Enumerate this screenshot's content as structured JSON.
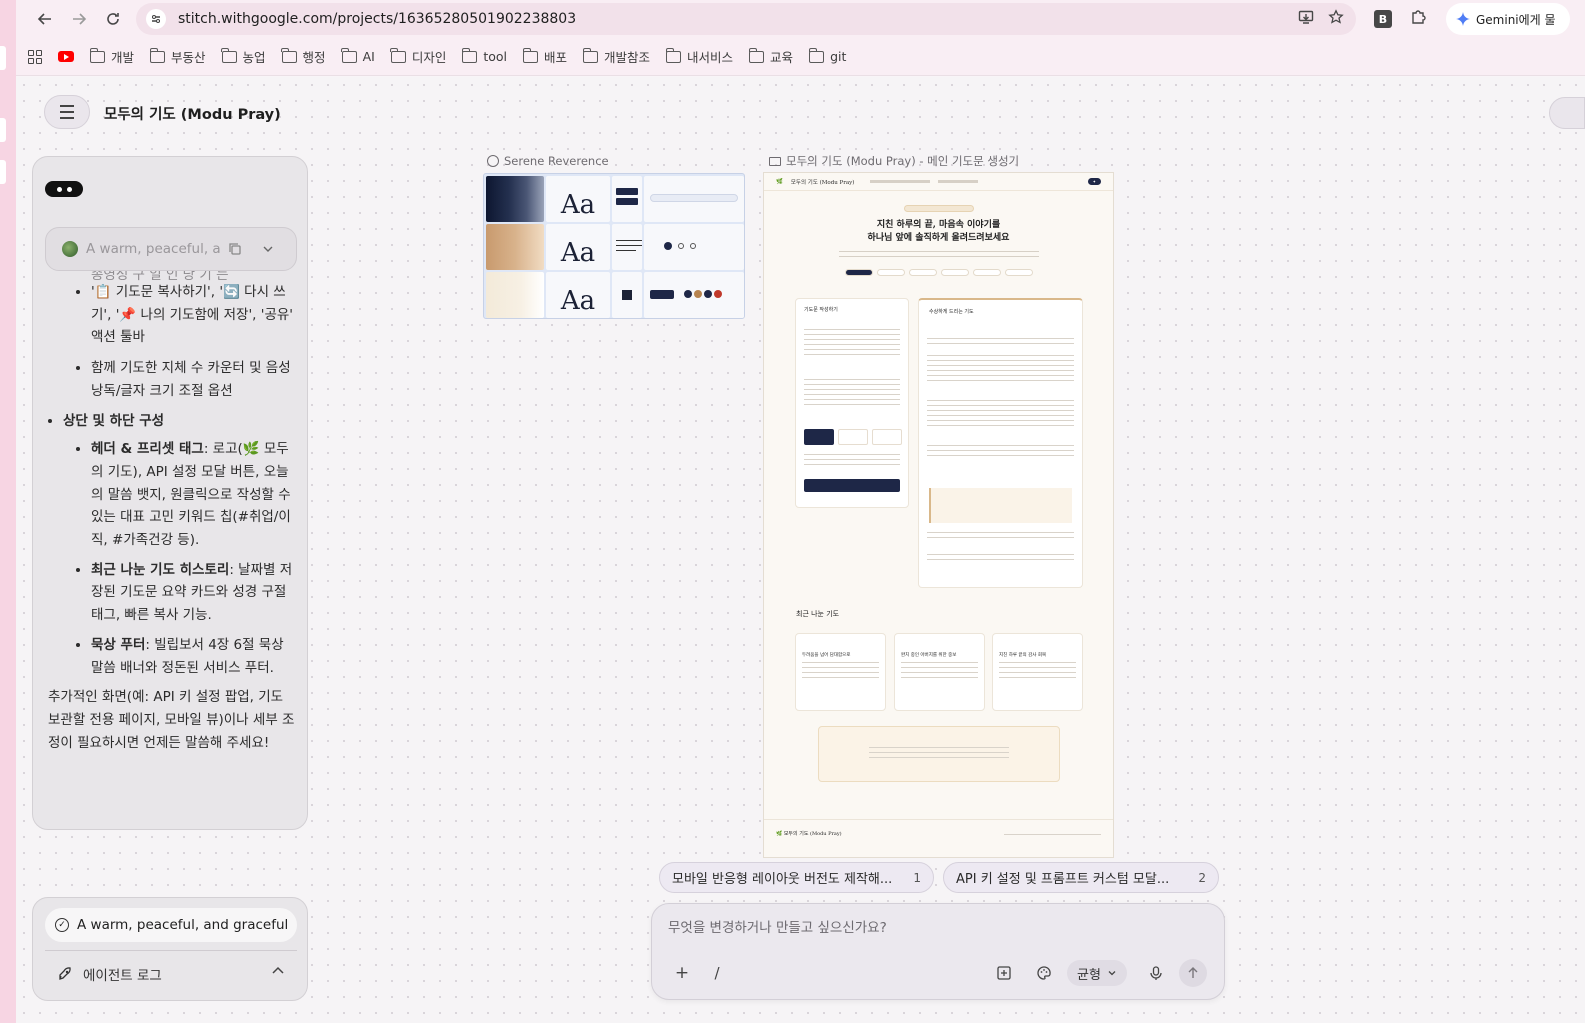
{
  "browser": {
    "url": "stitch.withgoogle.com/projects/16365280501902238803",
    "extension_badge": "B",
    "gemini_button": "Gemini에게 물",
    "bookmarks": [
      "개발",
      "부동산",
      "농업",
      "행정",
      "AI",
      "디자인",
      "tool",
      "배포",
      "개발참조",
      "내서비스",
      "교육",
      "git"
    ]
  },
  "app": {
    "project_title": "모두의 기도 (Modu Pray)"
  },
  "chat": {
    "theme_chip": "A warm, peaceful, a...",
    "cut_line": "종영성 구 일 인 당 기 는",
    "action_toolbar": "'📋 기도문 복사하기', '🔄 다시 쓰기', '📌 나의 기도함에 저장', '공유' 액션 툴바",
    "counter_item": "함께 기도한 지체 수 카운터 및 음성 낭독/글자 크기 조절 옵션",
    "section_heading": "상단 및 하단 구성",
    "header_title": "헤더 & 프리셋 태그",
    "header_text": ": 로고(🌿 모두의 기도), API 설정 모달 버튼, 오늘의 말씀 뱃지, 원클릭으로 작성할 수 있는 대표 고민 키워드 칩(#취업/이직, #가족건강 등).",
    "history_title": "최근 나눈 기도 히스토리",
    "history_text": ": 날짜별 저장된 기도문 요약 카드와 성경 구절 태그, 빠른 복사 기능.",
    "footer_title": "묵상 푸터",
    "footer_text": ": 빌립보서 4장 6절 묵상 말씀 배너와 정돈된 서비스 푸터.",
    "outro": "추가적인 화면(예: API 키 설정 팝업, 기도 보관할 전용 페이지, 모바일 뷰)이나 세부 조정이 필요하시면 언제든 말씀해 주세요!"
  },
  "agent": {
    "task": "A warm, peaceful, and graceful",
    "log_label": "에이전트 로그"
  },
  "canvas": {
    "design_system_label": "Serene Reverence",
    "screen_label": "모두의 기도 (Modu Pray) - 메인 기도문 생성기",
    "aa": "Aa",
    "preview": {
      "logo": "모두의 기도 (Modu Pray)",
      "hero_line1": "지친 하루의 끝, 마음속 이야기를",
      "hero_line2": "하나님 앞에 솔직하게 올려드려보세요",
      "card_left_title": "기도문 작성하기",
      "card_right_title": "수상하게 드리는 기도",
      "history_title": "최근 나눈 기도",
      "history_cards": [
        "두려움을 넘어 담대함으로",
        "완치 중인 아버지를 위한 중보",
        "지친 하루 끝의 감사 회복"
      ],
      "footer_logo": "모두의 기도 (Modu Pray)"
    }
  },
  "suggestions": [
    {
      "text": "모바일 반응형 레이아웃 버전도 제작해...",
      "count": "1"
    },
    {
      "text": "API 키 설정 및 프롬프트 커스텀 모달...",
      "count": "2"
    }
  ],
  "composer": {
    "placeholder": "무엇을 변경하거나 만들고 싶으신가요?",
    "slash": "/",
    "mode": "균형"
  }
}
